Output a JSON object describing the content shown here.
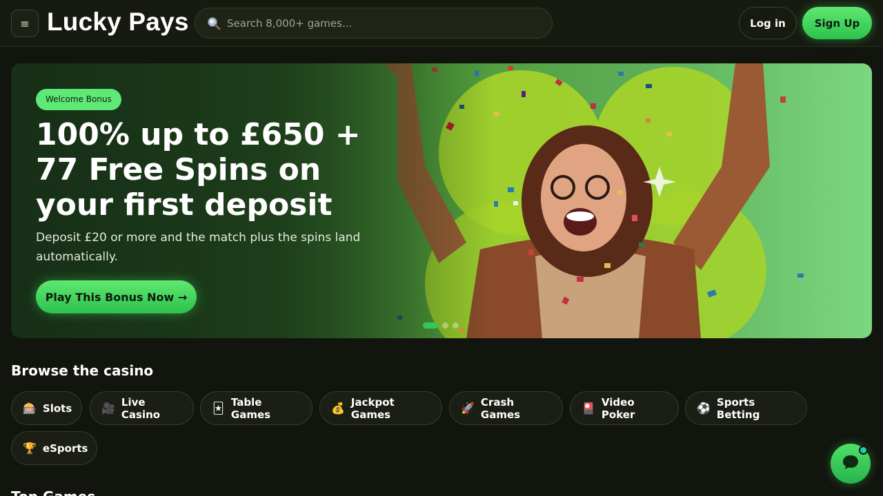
{
  "header": {
    "logo": "Lucky Pays",
    "search_placeholder": "Search 8,000+ games...",
    "login_label": "Log in",
    "signup_label": "Sign Up",
    "icons": {
      "menu": "hamburger-menu-icon",
      "search": "search-icon"
    }
  },
  "hero": {
    "badge": "Welcome Bonus",
    "title": "100% up to £650 + 77 Free Spins on your first deposit",
    "subtitle": "Deposit £20 or more and the match plus the spins land automatically.",
    "cta_label": "Play This Bonus Now →",
    "slides": {
      "count": 3,
      "active": 1
    }
  },
  "browse": {
    "title": "Browse the casino",
    "categories": [
      {
        "label": "Slots",
        "icon": "slot-machine-icon",
        "glyph": "🎰"
      },
      {
        "label": "Live Casino",
        "icon": "video-camera-icon",
        "glyph": "🎥"
      },
      {
        "label": "Table Games",
        "icon": "playing-card-icon",
        "glyph": "🃏"
      },
      {
        "label": "Jackpot Games",
        "icon": "money-bag-icon",
        "glyph": "💰"
      },
      {
        "label": "Crash Games",
        "icon": "rocket-icon",
        "glyph": "🚀"
      },
      {
        "label": "Video Poker",
        "icon": "card-icon",
        "glyph": "🎴"
      },
      {
        "label": "Sports Betting",
        "icon": "soccer-ball-icon",
        "glyph": "⚽"
      },
      {
        "label": "eSports",
        "icon": "trophy-icon",
        "glyph": "🏆"
      }
    ]
  },
  "next_section_title": "Top Games",
  "chat": {
    "icon": "chat-bubble-icon"
  },
  "colors": {
    "accent": "#34c759",
    "background": "#12140e",
    "header": "#161a10"
  }
}
